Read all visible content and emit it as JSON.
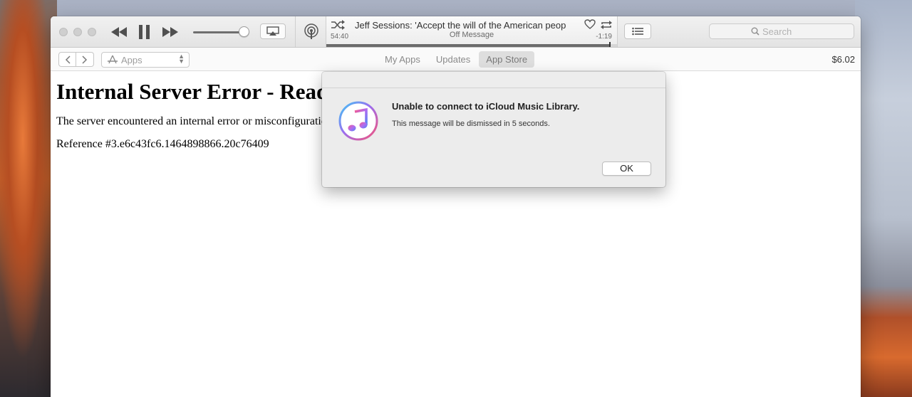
{
  "player": {
    "track_title": "Jeff Sessions: 'Accept the will of the American peop",
    "subtitle": "Off Message",
    "elapsed": "54:40",
    "remaining": "-1:19",
    "progress_fraction": 0.975,
    "volume_fraction": 0.9
  },
  "search": {
    "placeholder": "Search"
  },
  "navbar": {
    "media_kind": "Apps",
    "tabs": [
      {
        "label": "My Apps",
        "active": false
      },
      {
        "label": "Updates",
        "active": false
      },
      {
        "label": "App Store",
        "active": true
      }
    ],
    "balance": "$6.02"
  },
  "content": {
    "heading": "Internal Server Error - Read",
    "body": "The server encountered an internal error or misconfiguration",
    "reference": "Reference #3.e6c43fc6.1464898866.20c76409"
  },
  "dialog": {
    "headline": "Unable to connect to iCloud Music Library.",
    "message": "This message will be dismissed in 5 seconds.",
    "ok_label": "OK"
  },
  "icons": [
    "rewind-icon",
    "pause-icon",
    "fast-forward-icon",
    "airplay-icon",
    "podcast-icon",
    "shuffle-icon",
    "heart-icon",
    "repeat-icon",
    "list-icon",
    "search-icon",
    "back-arrow-icon",
    "forward-arrow-icon",
    "app-store-icon",
    "itunes-icon"
  ]
}
